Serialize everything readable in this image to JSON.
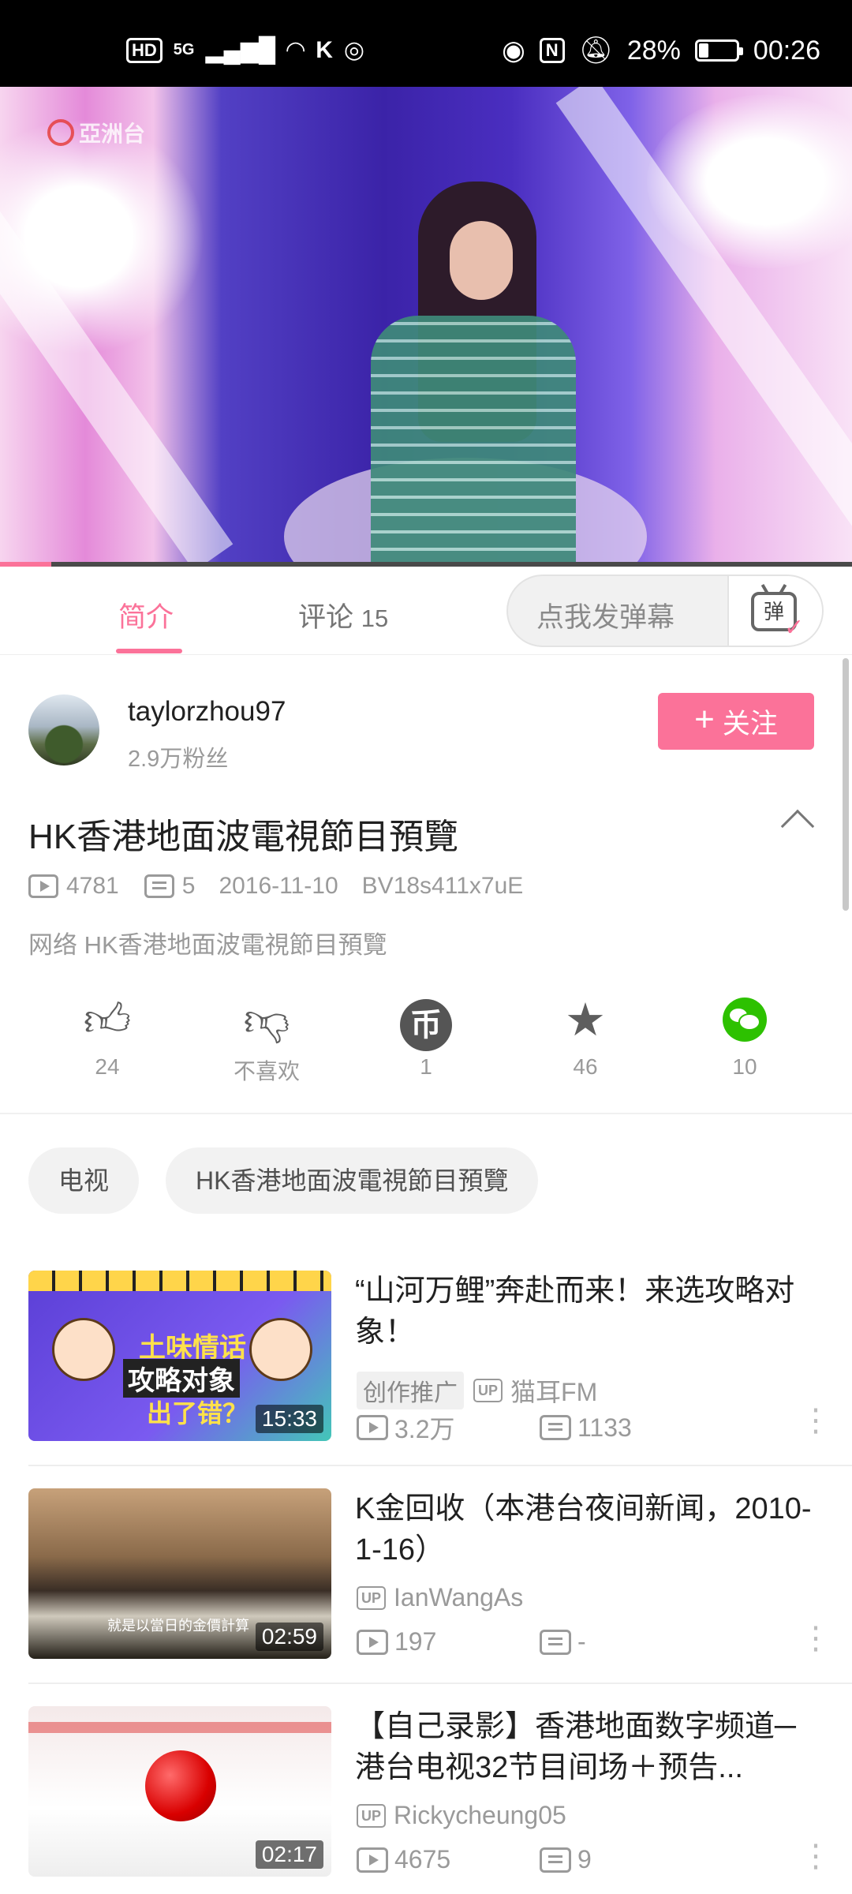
{
  "status_bar": {
    "left_icons": [
      "HD",
      "5G",
      "signal-icon",
      "wifi-icon",
      "k-icon",
      "hotspot-icon"
    ],
    "hd": "HD",
    "net": "5G",
    "battery_pct": "28%",
    "battery_level": 0.28,
    "time": "00:26"
  },
  "video": {
    "channel_logo": "亞洲台",
    "progress_fraction": 0.06
  },
  "tabs": {
    "intro": "简介",
    "comments": "评论",
    "comments_count": "15",
    "danmaku_placeholder": "点我发弹幕",
    "danmaku_btn": "弹"
  },
  "uploader": {
    "name": "taylorzhou97",
    "fans": "2.9万粉丝",
    "follow": "关注",
    "follow_plus": "+"
  },
  "video_info": {
    "title": "HK香港地面波電視節目預覽",
    "views": "4781",
    "danmaku": "5",
    "date": "2016-11-10",
    "bvid": "BV18s411x7uE",
    "description": "网络 HK香港地面波電視節目預覽"
  },
  "actions": [
    {
      "icon": "thumbs-up-icon",
      "label": "24"
    },
    {
      "icon": "thumbs-down-icon",
      "label": "不喜欢"
    },
    {
      "icon": "coin-icon",
      "glyph": "币",
      "label": "1"
    },
    {
      "icon": "star-icon",
      "label": "46"
    },
    {
      "icon": "wechat-share-icon",
      "label": "10"
    }
  ],
  "tags": [
    "电视",
    "HK香港地面波電視節目預覽"
  ],
  "related": [
    {
      "title": "“山河万鲤”奔赴而来！来选攻略对象！",
      "ad_tag": "创作推广",
      "up_badge": "UP",
      "owner": "猫耳FM",
      "views": "3.2万",
      "danmaku": "1133",
      "duration": "15:33",
      "thumb_text": [
        "土味情话",
        "攻略对象",
        "出了错？"
      ]
    },
    {
      "title": "K金回收（本港台夜间新闻，2010-1-16）",
      "up_badge": "UP",
      "owner": "IanWangAs",
      "views": "197",
      "danmaku": "-",
      "duration": "02:59",
      "thumb_text": [
        "就是以當日的金價計算"
      ]
    },
    {
      "title": "【自己录影】香港地面数字频道─港台电视32节目间场＋预告...",
      "up_badge": "UP",
      "owner": "Rickycheung05",
      "views": "4675",
      "danmaku": "9",
      "duration": "02:17"
    }
  ],
  "more_glyph": "⋮",
  "colors": {
    "accent": "#fb7299",
    "text": "#212121",
    "secondary": "#9a9a9a",
    "wechat": "#2dc100"
  }
}
